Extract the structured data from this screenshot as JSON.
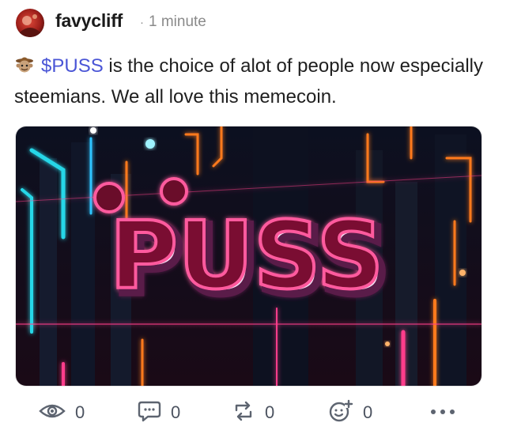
{
  "author": {
    "name": "favycliff",
    "separator": "·",
    "time_ago": "1 minute",
    "avatar_icon": "avatar"
  },
  "post": {
    "emoji_icon": "cowboy-emoji-icon",
    "ticker": "$PUSS",
    "text_rest": " is the choice of alot of people now especially steemians. We all love this memecoin."
  },
  "image": {
    "logo_text": "PUSS",
    "neon_pink": "#ff3d8b",
    "neon_orange": "#ff7a1a",
    "neon_cyan": "#27d7e8"
  },
  "actions": {
    "views": {
      "icon": "eye-icon",
      "count": "0"
    },
    "comments": {
      "icon": "comment-icon",
      "count": "0"
    },
    "reblogs": {
      "icon": "repost-icon",
      "count": "0"
    },
    "reactions": {
      "icon": "add-reaction-icon",
      "count": "0"
    },
    "more": {
      "icon": "more-icon"
    }
  },
  "colors": {
    "accent": "#4a55d6",
    "muted": "#8a8a8a",
    "icon": "#5d6470"
  }
}
